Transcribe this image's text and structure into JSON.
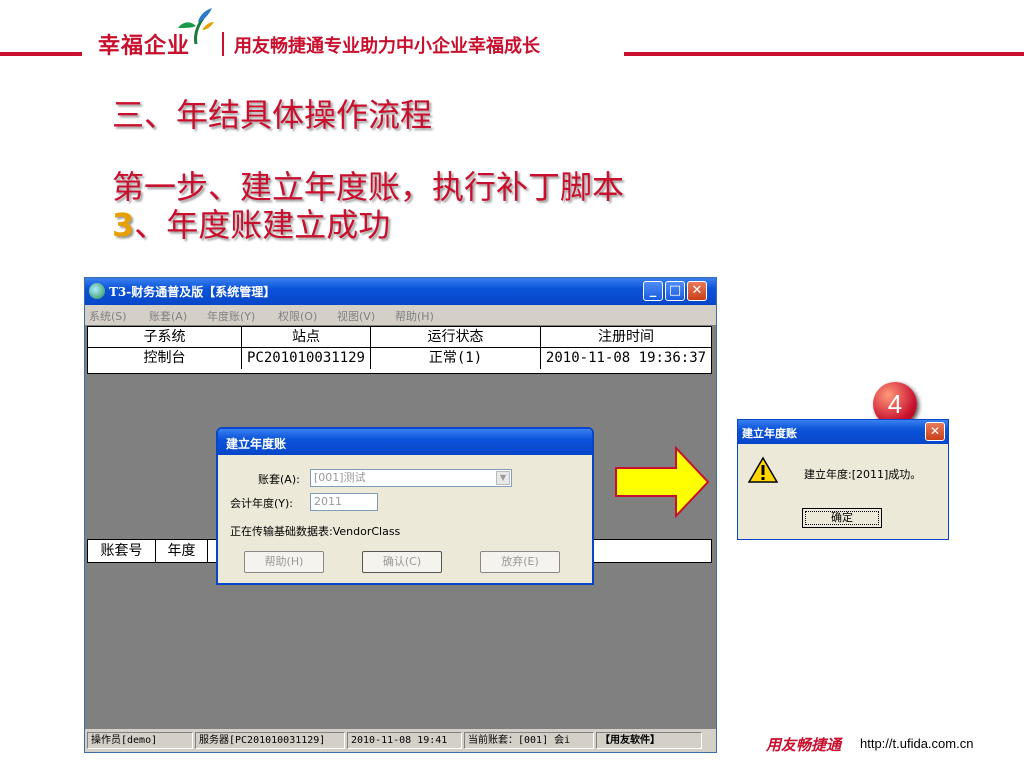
{
  "slide": {
    "brand": "幸福企业",
    "tagline": "用友畅捷通专业助力中小企业幸福成长",
    "title1": "三、年结具体操作流程",
    "title2": "第一步、建立年度账，执行补丁脚本",
    "title3_num": "3",
    "title3_rest": "、年度账建立成功",
    "badge": "4",
    "footer_brand": "用友畅捷通",
    "footer_url": "http://t.ufida.com.cn",
    "accent_color": "#c8102e"
  },
  "main_window": {
    "title": "T3-财务通普及版【系统管理】",
    "menu": [
      "系统(S)",
      "账套(A)",
      "年度账(Y)",
      "权限(O)",
      "视图(V)",
      "帮助(H)"
    ],
    "grid_headers": [
      "子系统",
      "站点",
      "运行状态",
      "注册时间"
    ],
    "grid_rows": [
      [
        "控制台",
        "PC201010031129",
        "正常(1)",
        "2010-11-08 19:36:37"
      ]
    ],
    "lower_headers": [
      "账套号",
      "年度"
    ],
    "status": [
      "操作员[demo]",
      "服务器[PC201010031129]",
      "2010-11-08 19:41",
      "当前账套：[001] 会i",
      "【用友软件】"
    ]
  },
  "dialog": {
    "title": "建立年度账",
    "account_label": "账套(A):",
    "account_value": "[001]测试",
    "year_label": "会计年度(Y):",
    "year_value": "2011",
    "progress_text": "正在传输基础数据表:VendorClass",
    "buttons": [
      "帮助(H)",
      "确认(C)",
      "放弃(E)"
    ]
  },
  "msgbox": {
    "title": "建立年度账",
    "text": "建立年度:[2011]成功。",
    "ok_label": "确定"
  }
}
